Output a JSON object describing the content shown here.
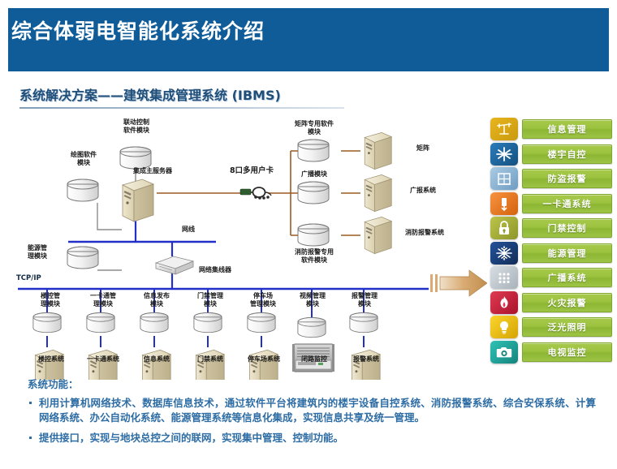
{
  "header": {
    "title": "综合体弱电智能化系统介绍",
    "band_color": "#0f5c99"
  },
  "section": {
    "subtitle": "系统解决方案——建筑集成管理系统 (IBMS)"
  },
  "diagram": {
    "top_module": "联动控制\n软件模块",
    "left_module_1": "绘图软件\n模块",
    "left_module_2": "能源管\n理模块",
    "main_server": "集成主服务器",
    "multiport_card": "8口多用户卡",
    "branch_modules": [
      "矩阵专用软件\n模块",
      "广播模块",
      "消防报警专用\n软件模块"
    ],
    "branch_systems": [
      "矩阵",
      "广报系统",
      "消防报警系统"
    ],
    "network_cable": "网线",
    "hub": "网络集线器",
    "protocol": "TCP/IP",
    "bus_modules": [
      "楼控管\n理模块",
      "一卡通管\n理模块",
      "信息发布\n模块",
      "门禁管理\n模块",
      "停车场\n管理模块",
      "视频管理\n模块",
      "报警管理\n模块"
    ],
    "bus_systems": [
      "楼控系统",
      "一卡通系统",
      "信息系统",
      "门禁系统",
      "停车场系统",
      "闭路监控",
      "报警系统"
    ]
  },
  "rail": {
    "items": [
      {
        "label": "信息管理",
        "icon": "antenna-icon",
        "icon_color": "#e8b51e",
        "icon_color2": "#c99a0f"
      },
      {
        "label": "楼宇自控",
        "icon": "snowflake-icon",
        "icon_color": "#1f6ba8",
        "icon_color2": "#14507f"
      },
      {
        "label": "防盗报警",
        "icon": "window-icon",
        "icon_color": "#8fb8d8",
        "icon_color2": "#6f9cc2"
      },
      {
        "label": "一卡通系统",
        "icon": "card-key-icon",
        "icon_color": "#f07c1e",
        "icon_color2": "#d4620c"
      },
      {
        "label": "门禁控制",
        "icon": "padlock-icon",
        "icon_color": "#aab33a",
        "icon_color2": "#8d9628"
      },
      {
        "label": "能源管理",
        "icon": "snow-energy-icon",
        "icon_color": "#1b3f7a",
        "icon_color2": "#122c58"
      },
      {
        "label": "广播系统",
        "icon": "speaker-grid-icon",
        "icon_color": "#c6ced4",
        "icon_color2": "#a8b2ba"
      },
      {
        "label": "火灾报警",
        "icon": "fire-icon",
        "icon_color": "#cf1f3c",
        "icon_color2": "#a8142c"
      },
      {
        "label": "泛光照明",
        "icon": "lightbulb-icon",
        "icon_color": "#f2c20e",
        "icon_color2": "#d5a506"
      },
      {
        "label": "电视监控",
        "icon": "camera-icon",
        "icon_color": "#1fa9a0",
        "icon_color2": "#14837c"
      }
    ],
    "button_color": "#9bc23f"
  },
  "notes": {
    "title": "系统功能：",
    "bullets": [
      "利用计算机网络技术、数据库信息技术，通过软件平台将建筑内的楼宇设备自控系统、消防报警系统、综合安保系统、计算网络系统、办公自动化系统、能源管理系统等信息化集成，实现信息共享及统一管理。",
      "提供接口，实现与地块总控之间的联网，实现集中管理、控制功能。"
    ]
  }
}
